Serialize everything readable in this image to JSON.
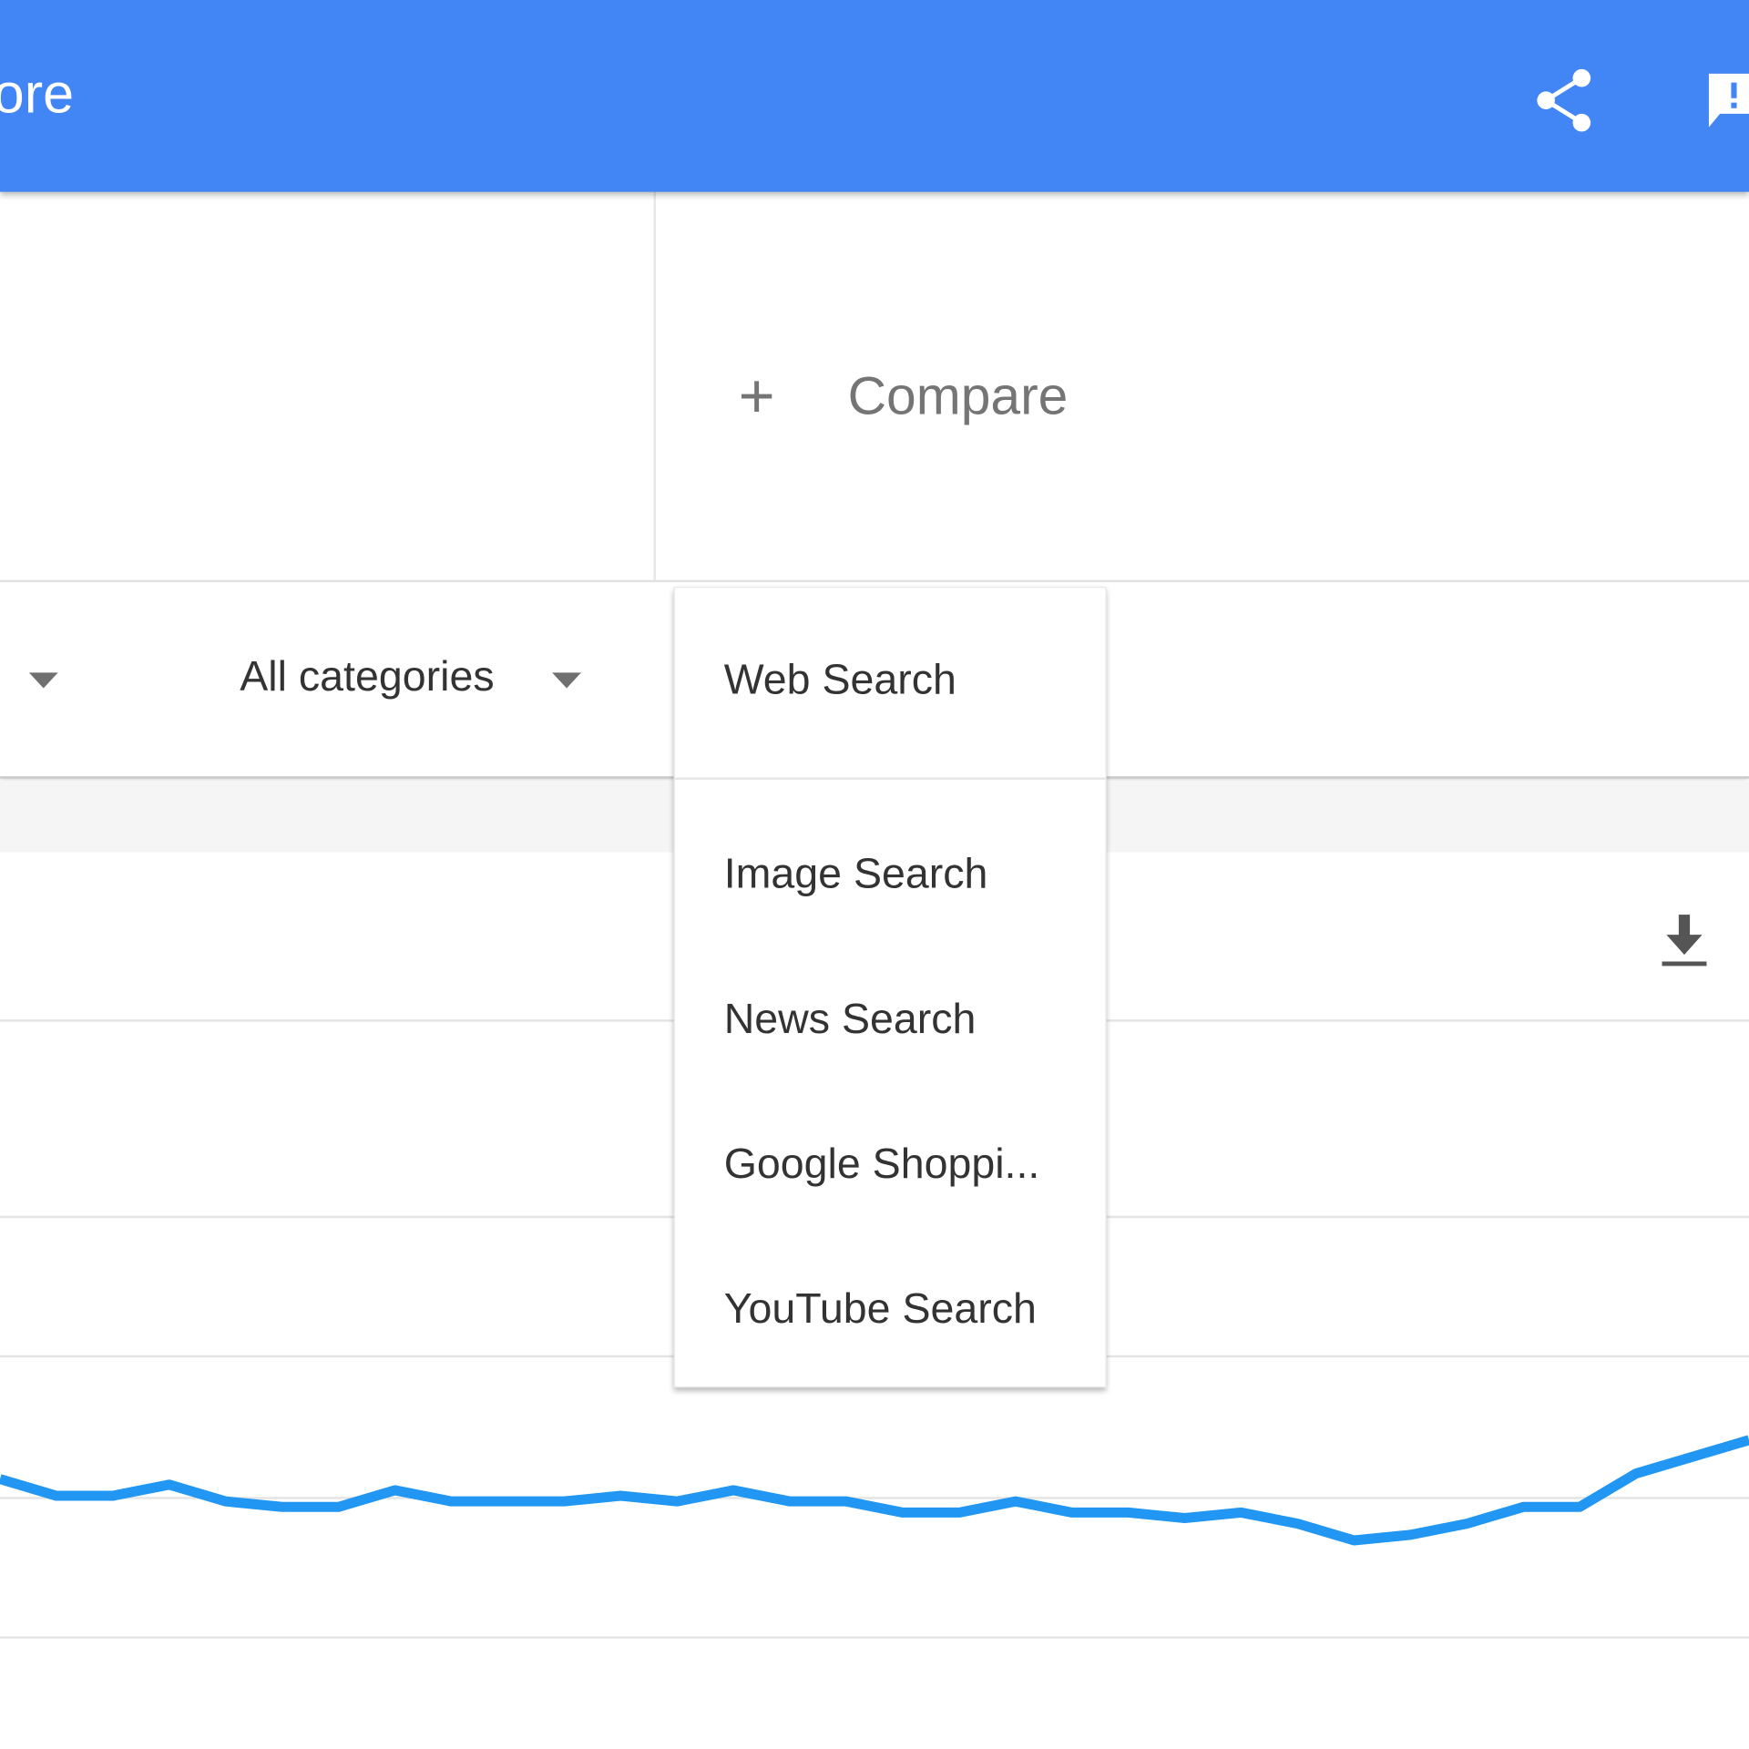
{
  "header": {
    "title_fragment": "ore",
    "color": "#4285f4",
    "icons": [
      "share-icon",
      "feedback-icon"
    ]
  },
  "compare": {
    "label": "Compare",
    "icon": "plus-icon"
  },
  "filters": {
    "category": "All categories"
  },
  "search_type_menu": {
    "selected": "Web Search",
    "items": [
      "Web Search",
      "Image Search",
      "News Search",
      "Google Shoppi...",
      "YouTube Search"
    ]
  },
  "chart_toolbar": {
    "icons": [
      "download-icon"
    ]
  },
  "chart_data": {
    "type": "line",
    "grid": true,
    "line_color": "#2196f3",
    "series": [
      {
        "values": [
          53,
          50,
          50,
          52,
          49,
          48,
          48,
          51,
          49,
          49,
          49,
          50,
          49,
          51,
          49,
          49,
          47,
          47,
          49,
          47,
          47,
          46,
          47,
          45,
          42,
          43,
          45,
          48,
          48,
          54,
          57,
          60
        ]
      }
    ]
  }
}
